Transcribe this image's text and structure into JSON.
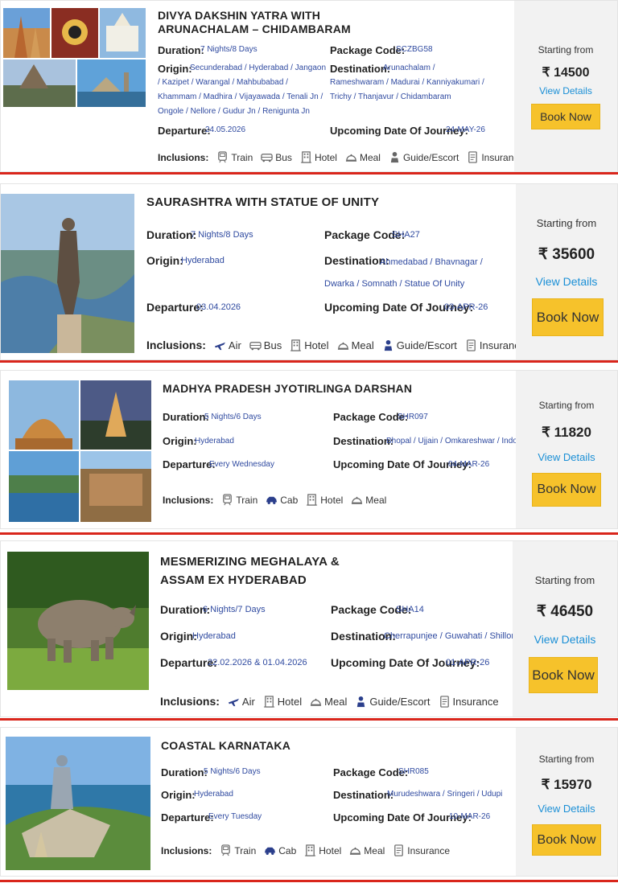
{
  "labels": {
    "duration": "Duration:",
    "package_code": "Package Code:",
    "origin": "Origin:",
    "destination": "Destination:",
    "departure": "Departure:",
    "upcoming": "Upcoming Date Of Journey:",
    "inclusions": "Inclusions:",
    "starting_from": "Starting from",
    "view_details": "View Details",
    "book_now": "Book Now"
  },
  "packages": [
    {
      "title": "DIVYA DAKSHIN YATRA WITH ARUNACHALAM – CHIDAMBARAM",
      "duration": "7 Nights/8 Days",
      "package_code": "SCZBG58",
      "origin": "Secunderabad / Hyderabad / Jangaon / Kazipet / Warangal / Mahbubabad / Khammam / Madhira / Vijayawada / Tenali Jn / Ongole / Nellore / Gudur Jn / Renigunta Jn",
      "destination": "Arunachalam / Rameshwaram / Madurai / Kanniyakumari / Trichy / Thanjavur / Chidambaram",
      "departure": "24.05.2026",
      "upcoming": "24-MAY-26",
      "price": "₹ 14500",
      "inclusions": [
        {
          "icon": "train-icon",
          "label": "Train"
        },
        {
          "icon": "bus-icon",
          "label": "Bus"
        },
        {
          "icon": "hotel-icon",
          "label": "Hotel"
        },
        {
          "icon": "meal-icon",
          "label": "Meal"
        },
        {
          "icon": "guide-icon",
          "label": "Guide/Escort"
        },
        {
          "icon": "insurance-icon",
          "label": "Insurance"
        }
      ]
    },
    {
      "title": "SAURASHTRA WITH STATUE OF UNITY",
      "duration": "7 Nights/8 Days",
      "package_code": "SHA27",
      "origin": "Hyderabad",
      "destination": "Ahmedabad / Bhavnagar / Dwarka / Somnath / Statue Of Unity",
      "departure": "03.04.2026",
      "upcoming": "03-APR-26",
      "price": "₹ 35600",
      "inclusions": [
        {
          "icon": "air-icon",
          "label": "Air"
        },
        {
          "icon": "bus-icon",
          "label": "Bus"
        },
        {
          "icon": "hotel-icon",
          "label": "Hotel"
        },
        {
          "icon": "meal-icon",
          "label": "Meal"
        },
        {
          "icon": "guide-icon",
          "label": "Guide/Escort"
        },
        {
          "icon": "insurance-icon",
          "label": "Insurance"
        }
      ]
    },
    {
      "title": "MADHYA PRADESH JYOTIRLINGA DARSHAN",
      "duration": "5 Nights/6 Days",
      "package_code": "SHR097",
      "origin": "Hyderabad",
      "destination": "Bhopal / Ujjain / Omkareshwar / Indore",
      "departure": "Every Wednesday",
      "upcoming": "04-MAR-26",
      "price": "₹ 11820",
      "inclusions": [
        {
          "icon": "train-icon",
          "label": "Train"
        },
        {
          "icon": "cab-icon",
          "label": "Cab"
        },
        {
          "icon": "hotel-icon",
          "label": "Hotel"
        },
        {
          "icon": "meal-icon",
          "label": "Meal"
        }
      ]
    },
    {
      "title": "MESMERIZING MEGHALAYA & ASSAM EX HYDERABAD",
      "duration": "6 Nights/7 Days",
      "package_code": "SHA14",
      "origin": "Hyderabad",
      "destination": "Cherrapunjee / Guwahati / Shillong",
      "departure": "22.02.2026 & 01.04.2026",
      "upcoming": "01-APR-26",
      "price": "₹ 46450",
      "inclusions": [
        {
          "icon": "air-icon",
          "label": "Air"
        },
        {
          "icon": "hotel-icon",
          "label": "Hotel"
        },
        {
          "icon": "meal-icon",
          "label": "Meal"
        },
        {
          "icon": "guide-icon",
          "label": "Guide/Escort"
        },
        {
          "icon": "insurance-icon",
          "label": "Insurance"
        }
      ]
    },
    {
      "title": "COASTAL KARNATAKA",
      "duration": "5 Nights/6 Days",
      "package_code": "SHR085",
      "origin": "Hyderabad",
      "destination": "Murudeshwara / Sringeri / Udupi",
      "departure": "Every Tuesday",
      "upcoming": "10-MAR-26",
      "price": "₹ 15970",
      "inclusions": [
        {
          "icon": "train-icon",
          "label": "Train"
        },
        {
          "icon": "cab-icon",
          "label": "Cab"
        },
        {
          "icon": "hotel-icon",
          "label": "Hotel"
        },
        {
          "icon": "meal-icon",
          "label": "Meal"
        },
        {
          "icon": "insurance-icon",
          "label": "Insurance"
        }
      ]
    }
  ]
}
